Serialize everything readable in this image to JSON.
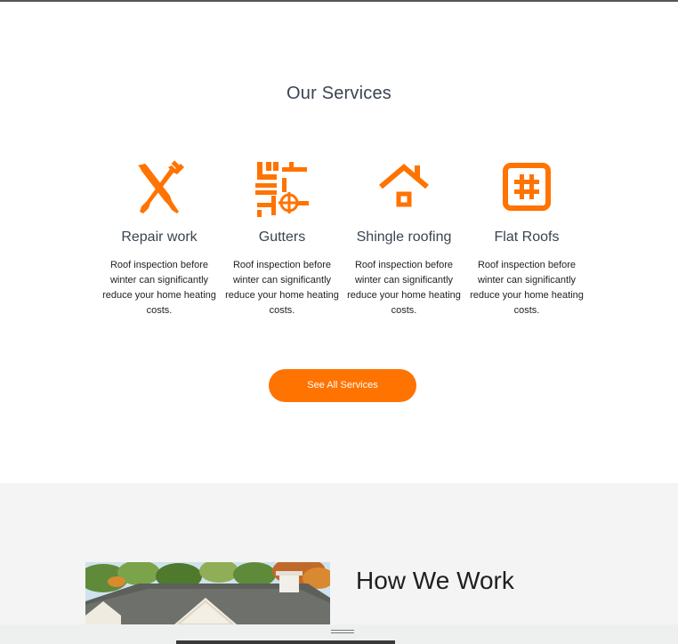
{
  "services_section": {
    "title": "Our Services",
    "items": [
      {
        "name": "Repair work",
        "icon": "hammer-screwdriver-icon",
        "description": "Roof inspection before winter can significantly reduce your home heating costs."
      },
      {
        "name": "Gutters",
        "icon": "pipes-icon",
        "description": "Roof inspection before winter can significantly reduce your home heating costs."
      },
      {
        "name": "Shingle roofing",
        "icon": "house-icon",
        "description": "Roof inspection before winter can significantly reduce your home heating costs."
      },
      {
        "name": "Flat Roofs",
        "icon": "hashtag-square-icon",
        "description": "Roof inspection before winter can significantly reduce your home heating costs."
      }
    ],
    "button_label": "See All Services"
  },
  "how_section": {
    "title": "How We Work"
  },
  "colors": {
    "accent": "#ff7300",
    "section_bg": "#f4f4f4",
    "heading": "#3a4452"
  }
}
